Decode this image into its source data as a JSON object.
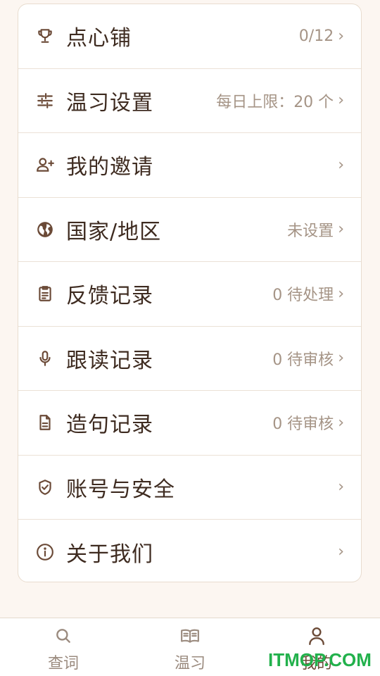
{
  "menu": [
    {
      "icon": "trophy-icon",
      "label": "点心铺",
      "value": "0/12"
    },
    {
      "icon": "sliders-icon",
      "label": "温习设置",
      "value": "每日上限：20 个"
    },
    {
      "icon": "add-person-icon",
      "label": "我的邀请",
      "value": ""
    },
    {
      "icon": "globe-icon",
      "label": "国家/地区",
      "value": "未设置"
    },
    {
      "icon": "clipboard-icon",
      "label": "反馈记录",
      "value": "0 待处理"
    },
    {
      "icon": "microphone-icon",
      "label": "跟读记录",
      "value": "0 待审核"
    },
    {
      "icon": "document-icon",
      "label": "造句记录",
      "value": "0 待审核"
    },
    {
      "icon": "shield-check-icon",
      "label": "账号与安全",
      "value": ""
    },
    {
      "icon": "info-icon",
      "label": "关于我们",
      "value": ""
    }
  ],
  "chevron": "›",
  "tabs": [
    {
      "icon": "search-icon",
      "label": "查词",
      "active": false
    },
    {
      "icon": "book-icon",
      "label": "温习",
      "active": false
    },
    {
      "icon": "person-icon",
      "label": "我的",
      "active": true
    }
  ],
  "watermark": "ITMOP.COM",
  "colors": {
    "accent": "#6b4a37",
    "muted": "#a59486",
    "background": "#fcf6f1",
    "watermark": "#22b14c"
  }
}
